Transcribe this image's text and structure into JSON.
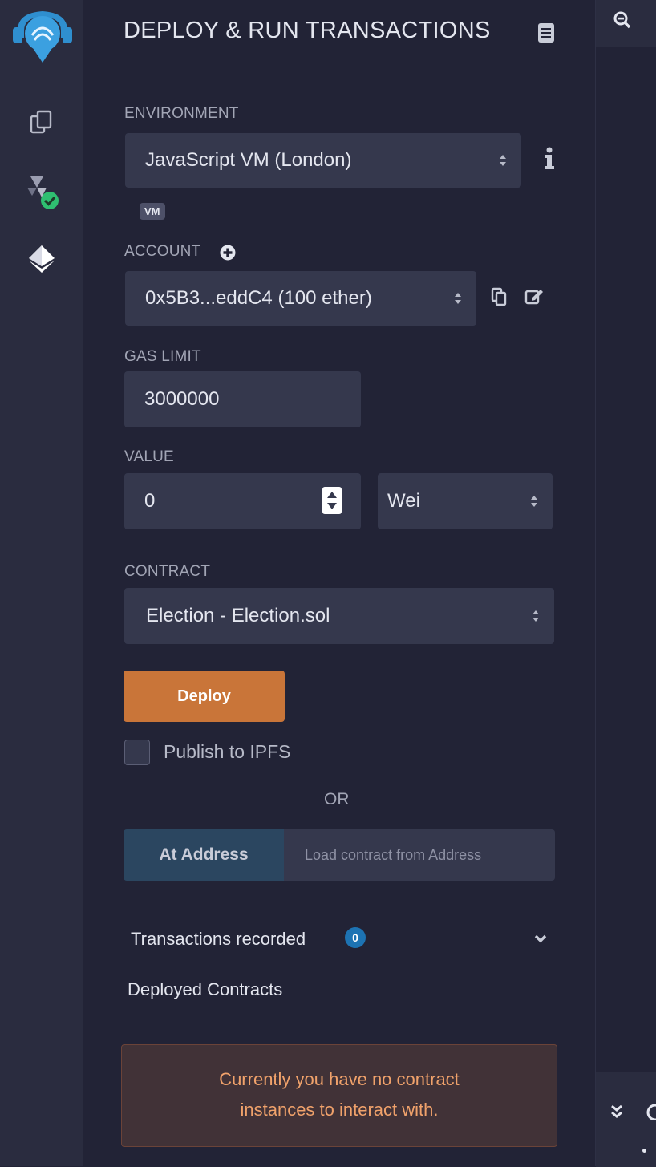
{
  "rail": {
    "icons": [
      "remix-logo-icon",
      "file-explorer-icon",
      "solidity-compiler-icon",
      "deploy-run-icon"
    ]
  },
  "panel": {
    "title": "DEPLOY & RUN TRANSACTIONS",
    "environment": {
      "label": "ENVIRONMENT",
      "value": "JavaScript VM (London)",
      "badge": "VM"
    },
    "account": {
      "label": "ACCOUNT",
      "value": "0x5B3...eddC4 (100 ether)"
    },
    "gas_limit": {
      "label": "GAS LIMIT",
      "value": "3000000"
    },
    "value": {
      "label": "VALUE",
      "amount": "0",
      "unit": "Wei"
    },
    "contract": {
      "label": "CONTRACT",
      "value": "Election - Election.sol"
    },
    "deploy_label": "Deploy",
    "publish_label": "Publish to IPFS",
    "or_label": "OR",
    "at_address": {
      "button_label": "At Address",
      "placeholder": "Load contract from Address"
    },
    "transactions": {
      "label": "Transactions recorded",
      "count": "0"
    },
    "deployed_label": "Deployed Contracts",
    "no_contracts_message_line1": "Currently you have no contract",
    "no_contracts_message_line2": "instances to interact with."
  },
  "colors": {
    "accent_deploy": "#c97539",
    "badge_count": "#1d73b3",
    "check_green": "#2fbf71",
    "warning_text": "#f0a26b"
  }
}
